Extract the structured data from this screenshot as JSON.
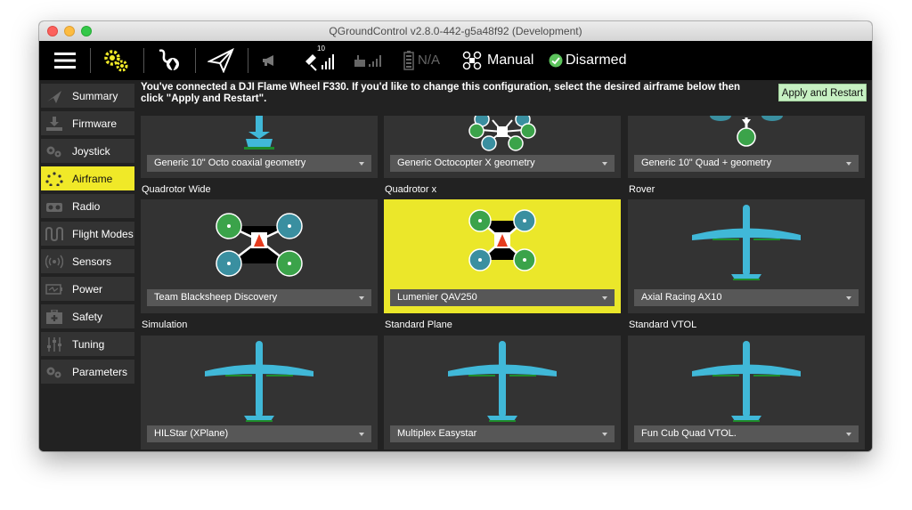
{
  "window": {
    "title": "QGroundControl v2.8.0-442-g5a48f92 (Development)"
  },
  "toolbar": {
    "satellite_count": "10",
    "battery": "N/A",
    "flight_mode": "Manual",
    "arm_status": "Disarmed",
    "colors": {
      "accent": "#f0e928",
      "armed_ok": "#5cc35c"
    }
  },
  "sidebar": {
    "items": [
      {
        "label": "Summary",
        "icon": "plane-icon"
      },
      {
        "label": "Firmware",
        "icon": "download-icon"
      },
      {
        "label": "Joystick",
        "icon": "gears-icon"
      },
      {
        "label": "Airframe",
        "icon": "airframe-icon",
        "active": true
      },
      {
        "label": "Radio",
        "icon": "radio-icon"
      },
      {
        "label": "Flight Modes",
        "icon": "wave-icon"
      },
      {
        "label": "Sensors",
        "icon": "sensors-icon"
      },
      {
        "label": "Power",
        "icon": "power-icon"
      },
      {
        "label": "Safety",
        "icon": "safety-icon"
      },
      {
        "label": "Tuning",
        "icon": "sliders-icon"
      },
      {
        "label": "Parameters",
        "icon": "gears-icon"
      }
    ]
  },
  "main": {
    "message": "You've connected a DJI Flame Wheel F330. If you'd like to change this configuration, select the desired airframe below then click \"Apply and Restart\".",
    "apply_button": "Apply and Restart",
    "rows": [
      {
        "cards": [
          {
            "title": "",
            "selected_value": "Generic 10\" Octo coaxial geometry"
          },
          {
            "title": "",
            "selected_value": "Generic Octocopter X geometry"
          },
          {
            "title": "",
            "selected_value": "Generic 10\" Quad + geometry"
          }
        ]
      },
      {
        "cards": [
          {
            "title": "Quadrotor Wide",
            "selected_value": "Team Blacksheep Discovery"
          },
          {
            "title": "Quadrotor x",
            "selected_value": "Lumenier QAV250",
            "selected": true
          },
          {
            "title": "Rover",
            "selected_value": "Axial Racing AX10"
          }
        ]
      },
      {
        "cards": [
          {
            "title": "Simulation",
            "selected_value": "HILStar (XPlane)"
          },
          {
            "title": "Standard Plane",
            "selected_value": "Multiplex Easystar"
          },
          {
            "title": "Standard VTOL",
            "selected_value": "Fun Cub Quad VTOL."
          }
        ]
      }
    ]
  }
}
